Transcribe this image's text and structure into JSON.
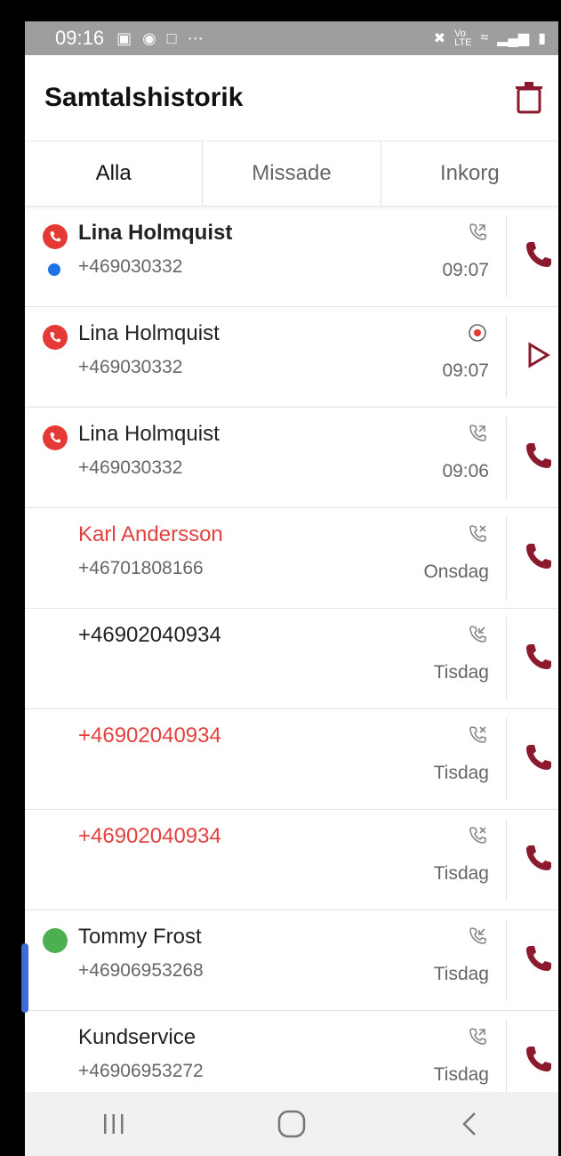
{
  "status_bar": {
    "time": "09:16",
    "left_icons": [
      "image-icon",
      "sync-icon",
      "screenshot-icon",
      "more-icon"
    ],
    "right_icons": [
      "mute-icon",
      "volte-icon",
      "wifi-icon",
      "signal-icon",
      "battery-icon"
    ]
  },
  "app_bar": {
    "title": "Samtalshistorik",
    "action_icon": "trash-icon",
    "accent": "#8b1a2f"
  },
  "tabs": [
    {
      "label": "Alla",
      "active": true
    },
    {
      "label": "Missade",
      "active": false
    },
    {
      "label": "Inkorg",
      "active": false
    }
  ],
  "calls": [
    {
      "name": "Lina Holmquist",
      "number": "+469030332",
      "time": "09:07",
      "call_type": "outgoing-call-icon",
      "action": "call-icon",
      "avatar": "red-phone",
      "bold": true,
      "unread": true,
      "missed": false
    },
    {
      "name": "Lina Holmquist",
      "number": "+469030332",
      "time": "09:07",
      "call_type": "recording-icon",
      "action": "play-icon",
      "avatar": "red-phone",
      "bold": false,
      "unread": false,
      "missed": false
    },
    {
      "name": "Lina Holmquist",
      "number": "+469030332",
      "time": "09:06",
      "call_type": "outgoing-call-icon",
      "action": "call-icon",
      "avatar": "red-phone",
      "bold": false,
      "unread": false,
      "missed": false
    },
    {
      "name": "Karl Andersson",
      "number": "+46701808166",
      "time": "Onsdag",
      "call_type": "missed-call-icon",
      "action": "call-icon",
      "avatar": "",
      "bold": false,
      "unread": false,
      "missed": true
    },
    {
      "name": "+46902040934",
      "number": "",
      "time": "Tisdag",
      "call_type": "incoming-call-icon",
      "action": "call-icon",
      "avatar": "",
      "bold": false,
      "unread": false,
      "missed": false
    },
    {
      "name": "+46902040934",
      "number": "",
      "time": "Tisdag",
      "call_type": "missed-call-icon",
      "action": "call-icon",
      "avatar": "",
      "bold": false,
      "unread": false,
      "missed": true
    },
    {
      "name": "+46902040934",
      "number": "",
      "time": "Tisdag",
      "call_type": "missed-call-icon",
      "action": "call-icon",
      "avatar": "",
      "bold": false,
      "unread": false,
      "missed": true
    },
    {
      "name": "Tommy Frost",
      "number": "+46906953268",
      "time": "Tisdag",
      "call_type": "incoming-call-icon",
      "action": "call-icon",
      "avatar": "green-status",
      "bold": false,
      "unread": false,
      "missed": false
    },
    {
      "name": "Kundservice",
      "number": "+46906953272",
      "time": "Tisdag",
      "call_type": "outgoing-call-icon",
      "action": "call-icon",
      "avatar": "",
      "bold": false,
      "unread": false,
      "missed": false
    }
  ],
  "colors": {
    "missed": "#e4403f",
    "accent": "#8b1a2f",
    "unread": "#1e74e6",
    "avatar_red": "#e53935",
    "status_green": "#4caf50"
  },
  "nav_bar": [
    "recent-apps-icon",
    "home-icon",
    "back-icon"
  ]
}
